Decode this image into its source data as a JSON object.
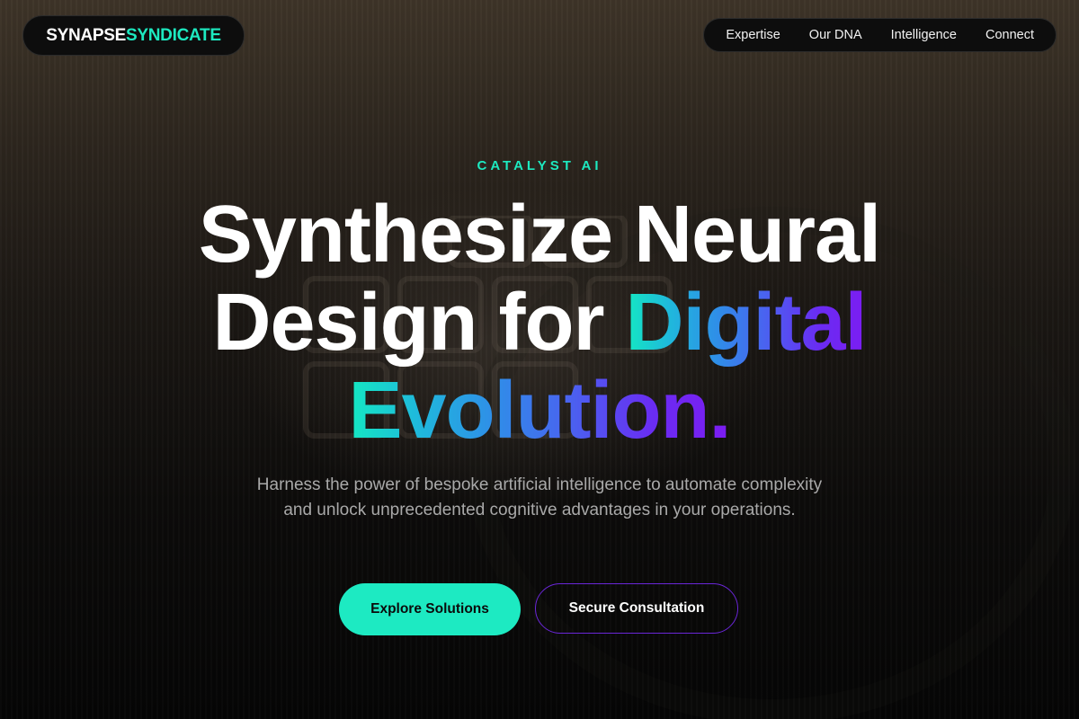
{
  "header": {
    "logo": {
      "part1": "SYNAPSE",
      "part2": "SYNDICATE"
    },
    "nav": [
      {
        "label": "Expertise"
      },
      {
        "label": "Our DNA"
      },
      {
        "label": "Intelligence"
      },
      {
        "label": "Connect"
      }
    ]
  },
  "hero": {
    "eyebrow": "CATALYST AI",
    "headline": {
      "line1": "Synthesize Neural",
      "line2_plain": "Design for ",
      "line2_accent": "Digital",
      "line3_accent": "Evolution."
    },
    "subtitle": "Harness the power of bespoke artificial intelligence to automate complexity and unlock unprecedented cognitive advantages in your operations.",
    "primary_button": "Explore Solutions",
    "secondary_button": "Secure Consultation"
  },
  "colors": {
    "accent": "#1de9c0",
    "gradient_start": "#14e8c2",
    "gradient_end": "#7c1cf2",
    "secondary_border": "#6a26d8"
  }
}
